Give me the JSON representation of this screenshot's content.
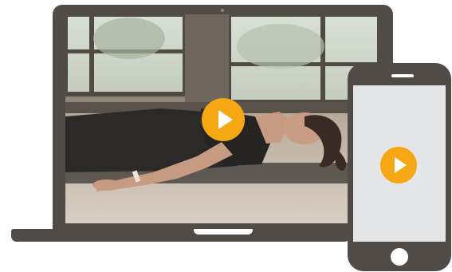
{
  "laptop": {
    "video_thumbnail": "yoga-woman-lying-on-mat",
    "play_icon": "play-icon"
  },
  "phone": {
    "play_icon": "play-icon"
  },
  "colors": {
    "device_frame": "#504b46",
    "play_button": "#f5a814",
    "play_glyph": "#ffffff",
    "phone_screen": "#e4e5e7"
  }
}
